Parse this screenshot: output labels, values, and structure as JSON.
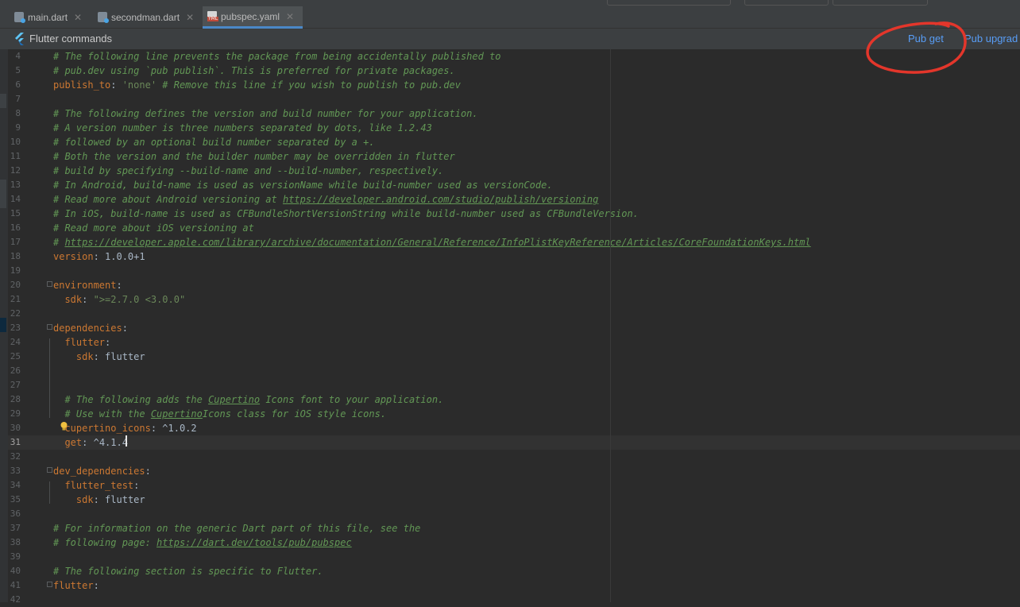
{
  "tabs": [
    {
      "label": "main.dart",
      "icon": "dart-file-icon"
    },
    {
      "label": "secondman.dart",
      "icon": "dart-file-icon"
    },
    {
      "label": "pubspec.yaml",
      "icon": "yaml-file-icon",
      "active": true
    }
  ],
  "toolbar": {
    "title": "Flutter commands",
    "pub_get": "Pub get",
    "pub_upgrade": "Pub upgrad"
  },
  "colors": {
    "background": "#2b2b2b",
    "keyword": "#cc7832",
    "string": "#6a8759",
    "comment": "#629755",
    "link": "#589df6",
    "annotation": "#e3362b"
  },
  "editor": {
    "current_line": 31,
    "lines": [
      {
        "n": "4",
        "tokens": [
          {
            "t": "c",
            "v": "# The following line prevents the package from being accidentally published to"
          }
        ]
      },
      {
        "n": "5",
        "tokens": [
          {
            "t": "c",
            "v": "# pub.dev using `pub publish`. This is preferred for private packages."
          }
        ]
      },
      {
        "n": "6",
        "tokens": [
          {
            "t": "k",
            "v": "publish_to"
          },
          {
            "t": "v",
            "v": ": "
          },
          {
            "t": "s",
            "v": "'none'"
          },
          {
            "t": "c",
            "v": " # Remove this line if you wish to publish to pub.dev"
          }
        ]
      },
      {
        "n": "7",
        "tokens": []
      },
      {
        "n": "8",
        "tokens": [
          {
            "t": "c",
            "v": "# The following defines the version and build number for your application."
          }
        ]
      },
      {
        "n": "9",
        "tokens": [
          {
            "t": "c",
            "v": "# A version number is three numbers separated by dots, like 1.2.43"
          }
        ]
      },
      {
        "n": "10",
        "tokens": [
          {
            "t": "c",
            "v": "# followed by an optional build number separated by a +."
          }
        ]
      },
      {
        "n": "11",
        "tokens": [
          {
            "t": "c",
            "v": "# Both the version and the builder number may be overridden in flutter"
          }
        ]
      },
      {
        "n": "12",
        "tokens": [
          {
            "t": "c",
            "v": "# build by specifying --build-name and --build-number, respectively."
          }
        ]
      },
      {
        "n": "13",
        "tokens": [
          {
            "t": "c",
            "v": "# In Android, build-name is used as versionName while build-number used as versionCode."
          }
        ]
      },
      {
        "n": "14",
        "tokens": [
          {
            "t": "c",
            "v": "# Read more about Android versioning at "
          },
          {
            "t": "cu",
            "v": "https://developer.android.com/studio/publish/versioning"
          }
        ]
      },
      {
        "n": "15",
        "tokens": [
          {
            "t": "c",
            "v": "# In iOS, build-name is used as CFBundleShortVersionString while build-number used as CFBundleVersion."
          }
        ]
      },
      {
        "n": "16",
        "tokens": [
          {
            "t": "c",
            "v": "# Read more about iOS versioning at"
          }
        ]
      },
      {
        "n": "17",
        "tokens": [
          {
            "t": "c",
            "v": "# "
          },
          {
            "t": "cu",
            "v": "https://developer.apple.com/library/archive/documentation/General/Reference/InfoPlistKeyReference/Articles/CoreFoundationKeys.html"
          }
        ]
      },
      {
        "n": "18",
        "tokens": [
          {
            "t": "k",
            "v": "version"
          },
          {
            "t": "v",
            "v": ": 1.0.0+1"
          }
        ]
      },
      {
        "n": "19",
        "tokens": []
      },
      {
        "n": "20",
        "tokens": [
          {
            "t": "k",
            "v": "environment"
          },
          {
            "t": "v",
            "v": ":"
          }
        ]
      },
      {
        "n": "21",
        "tokens": [
          {
            "t": "v",
            "v": "  "
          },
          {
            "t": "k",
            "v": "sdk"
          },
          {
            "t": "v",
            "v": ": "
          },
          {
            "t": "s",
            "v": "\">=2.7.0 <3.0.0\""
          }
        ]
      },
      {
        "n": "22",
        "tokens": []
      },
      {
        "n": "23",
        "tokens": [
          {
            "t": "k",
            "v": "dependencies"
          },
          {
            "t": "v",
            "v": ":"
          }
        ]
      },
      {
        "n": "24",
        "tokens": [
          {
            "t": "v",
            "v": "  "
          },
          {
            "t": "k",
            "v": "flutter"
          },
          {
            "t": "v",
            "v": ":"
          }
        ]
      },
      {
        "n": "25",
        "tokens": [
          {
            "t": "v",
            "v": "    "
          },
          {
            "t": "k",
            "v": "sdk"
          },
          {
            "t": "v",
            "v": ": flutter"
          }
        ]
      },
      {
        "n": "26",
        "tokens": []
      },
      {
        "n": "27",
        "tokens": []
      },
      {
        "n": "28",
        "tokens": [
          {
            "t": "v",
            "v": "  "
          },
          {
            "t": "c",
            "v": "# The following adds the "
          },
          {
            "t": "cu",
            "v": "Cupertino"
          },
          {
            "t": "c",
            "v": " Icons font to your application."
          }
        ]
      },
      {
        "n": "29",
        "tokens": [
          {
            "t": "v",
            "v": "  "
          },
          {
            "t": "c",
            "v": "# Use with the "
          },
          {
            "t": "cu",
            "v": "Cupertino"
          },
          {
            "t": "c",
            "v": "Icons class for iOS style icons."
          }
        ]
      },
      {
        "n": "30",
        "tokens": [
          {
            "t": "v",
            "v": "  "
          },
          {
            "t": "k",
            "v": "cupertino_icons"
          },
          {
            "t": "v",
            "v": ": ^1.0.2"
          }
        ]
      },
      {
        "n": "31",
        "tokens": [
          {
            "t": "v",
            "v": "  "
          },
          {
            "t": "k",
            "v": "get"
          },
          {
            "t": "v",
            "v": ": ^4.1.4"
          }
        ]
      },
      {
        "n": "32",
        "tokens": []
      },
      {
        "n": "33",
        "tokens": [
          {
            "t": "k",
            "v": "dev_dependencies"
          },
          {
            "t": "v",
            "v": ":"
          }
        ]
      },
      {
        "n": "34",
        "tokens": [
          {
            "t": "v",
            "v": "  "
          },
          {
            "t": "k",
            "v": "flutter_test"
          },
          {
            "t": "v",
            "v": ":"
          }
        ]
      },
      {
        "n": "35",
        "tokens": [
          {
            "t": "v",
            "v": "    "
          },
          {
            "t": "k",
            "v": "sdk"
          },
          {
            "t": "v",
            "v": ": flutter"
          }
        ]
      },
      {
        "n": "36",
        "tokens": []
      },
      {
        "n": "37",
        "tokens": [
          {
            "t": "c",
            "v": "# For information on the generic Dart part of this file, see the"
          }
        ]
      },
      {
        "n": "38",
        "tokens": [
          {
            "t": "c",
            "v": "# following page: "
          },
          {
            "t": "cu",
            "v": "https://dart.dev/tools/pub/pubspec"
          }
        ]
      },
      {
        "n": "39",
        "tokens": []
      },
      {
        "n": "40",
        "tokens": [
          {
            "t": "c",
            "v": "# The following section is specific to Flutter."
          }
        ]
      },
      {
        "n": "41",
        "tokens": [
          {
            "t": "k",
            "v": "flutter"
          },
          {
            "t": "v",
            "v": ":"
          }
        ]
      },
      {
        "n": "42",
        "tokens": []
      }
    ]
  }
}
